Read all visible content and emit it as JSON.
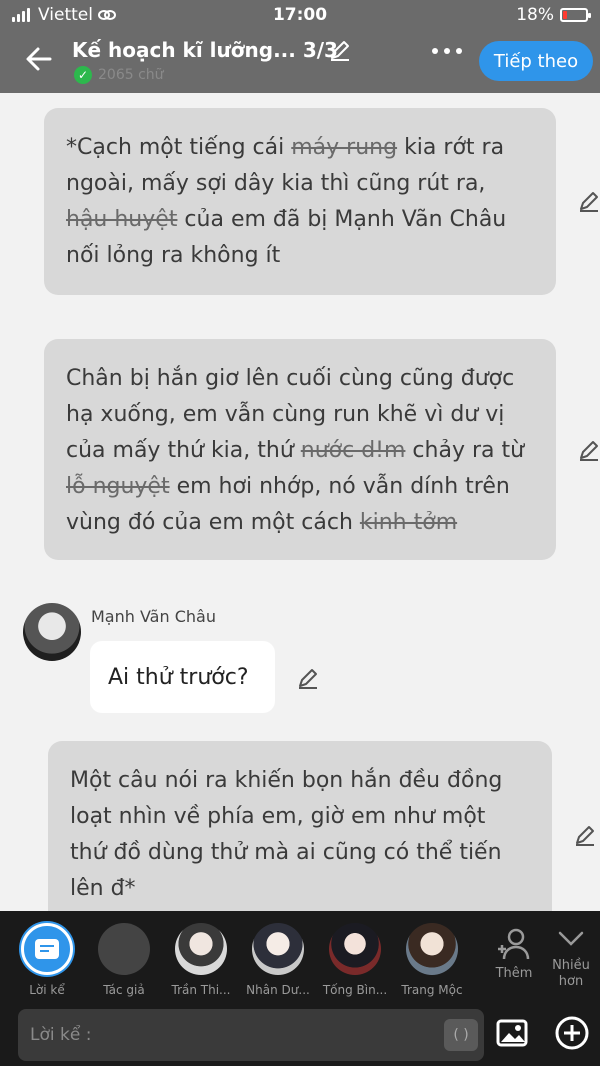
{
  "status_bar": {
    "carrier": "Viettel",
    "time": "17:00",
    "battery": "18%",
    "battery_level": 0.18
  },
  "header": {
    "title": "Kế hoạch kĩ lưỡng... 3/3",
    "word_count": "2065 chữ",
    "next_label": "Tiếp theo"
  },
  "messages": [
    {
      "type": "narration",
      "lines": [
        [
          {
            "t": "*Cạch một tiếng cái "
          },
          {
            "t": "máy rung",
            "s": true
          },
          {
            "t": " kia rớt ra"
          }
        ],
        [
          {
            "t": "ngoài, mấy sợi dây kia thì cũng rút ra,"
          }
        ],
        [
          {
            "t": "hậu huyệt",
            "s": true
          },
          {
            "t": " của em đã bị Mạnh Vãn Châu"
          }
        ],
        [
          {
            "t": "nối lỏng ra không ít"
          }
        ]
      ]
    },
    {
      "type": "narration",
      "lines": [
        [
          {
            "t": "Chân bị hắn giơ lên cuối cùng cũng được"
          }
        ],
        [
          {
            "t": "hạ xuống, em vẫn cùng run khẽ vì dư vị"
          }
        ],
        [
          {
            "t": "của mấy thứ kia, thứ "
          },
          {
            "t": "nước d!m",
            "s": true
          },
          {
            "t": " chảy ra từ"
          }
        ],
        [
          {
            "t": "lỗ nguyệt",
            "s": true
          },
          {
            "t": " em hơi nhớp, nó vẫn dính trên"
          }
        ],
        [
          {
            "t": "vùng đó của em một cách "
          },
          {
            "t": "kinh tởm",
            "s": true
          }
        ]
      ]
    },
    {
      "type": "character",
      "name": "Mạnh Vãn Châu",
      "text": "Ai thử trước?"
    },
    {
      "type": "narration",
      "lines": [
        [
          {
            "t": "Một câu nói ra khiến bọn hắn đều đồng"
          }
        ],
        [
          {
            "t": "loạt nhìn về phía em, giờ em như một"
          }
        ],
        [
          {
            "t": "thứ đồ dùng thử mà ai cũng có thể tiến"
          }
        ],
        [
          {
            "t": "lên đ*"
          }
        ]
      ]
    }
  ],
  "characters": [
    {
      "label": "Lời kể",
      "active": true
    },
    {
      "label": "Tác giả"
    },
    {
      "label": "Trần Thi..."
    },
    {
      "label": "Nhân Dư..."
    },
    {
      "label": "Tống Bìn..."
    },
    {
      "label": "Trang Mộc"
    }
  ],
  "side_buttons": {
    "add_label": "Thêm",
    "more_label": "Nhiều hơn"
  },
  "composer": {
    "placeholder": "Lời kể :",
    "paren_label": "( )"
  },
  "colors": {
    "accent": "#2f95ea",
    "header_bg": "#6b6b6b",
    "narration_bg": "#d8d8d8",
    "bottom_bg": "#1a1a1a"
  }
}
